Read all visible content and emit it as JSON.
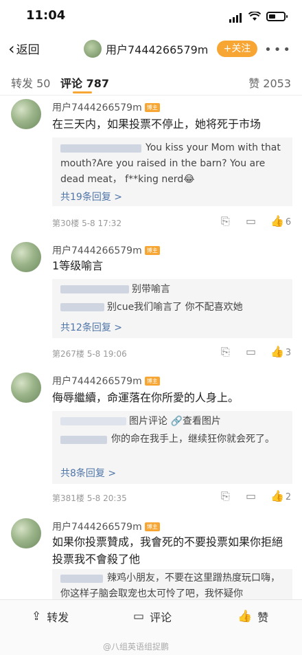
{
  "status": {
    "time": "11:04"
  },
  "nav": {
    "back_label": "返回",
    "username": "用户7444266579m",
    "follow_label": "+关注",
    "more_label": "•••"
  },
  "tabs": {
    "repost": "转发 50",
    "comments": "评论 787",
    "likes": "赞 2053"
  },
  "badge": "博主",
  "comments": [
    {
      "user": "用户7444266579m",
      "text": "在三天内，如果投票不停止，她将死于市场",
      "replies": [
        "You kiss your Mom with that mouth?Are you raised in the barn? You are dead meat，  f**king nerd😂"
      ],
      "more": "共19条回复 >",
      "meta": "第30楼  5-8 17:32",
      "likes": "6"
    },
    {
      "user": "用户7444266579m",
      "text": "1等级喻言",
      "replies": [
        "别带喻言",
        "别cue我们喻言了 你不配喜欢她"
      ],
      "more": "共12条回复 >",
      "meta": "第267楼  5-8 19:06",
      "likes": "3"
    },
    {
      "user": "用户7444266579m",
      "text": "侮辱繼續，命運落在你所愛的人身上。",
      "replies": [
        "图片评论 🔗查看图片",
        "你的命在我手上，继续狂你就会死了。"
      ],
      "more": "共8条回复 >",
      "meta": "第381楼  5-8 20:35",
      "likes": "2"
    },
    {
      "user": "用户7444266579m",
      "text": "如果你投票贊成，我會死的不要投票如果你拒絕投票我不會殺了他",
      "replies": [
        "辣鸡小朋友，不要在这里蹭热度玩口嗨，你这样子脑会取宠也太可怜了吧，我怀疑你"
      ],
      "more": "",
      "meta": "",
      "likes": ""
    }
  ],
  "bottom": {
    "repost": "转发",
    "comment": "评论",
    "like": "赞"
  },
  "watermark": "@八组英语组捉鹏"
}
